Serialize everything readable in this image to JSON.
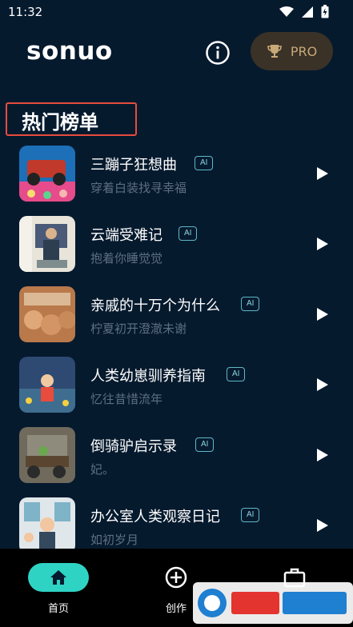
{
  "status_bar": {
    "time": "11:32"
  },
  "app_bar": {
    "title": "sonuo",
    "pro_label": "PRO"
  },
  "section": {
    "title": "热门榜单"
  },
  "songs": [
    {
      "title": "三蹦子狂想曲",
      "badge": "AI",
      "artist": "穿着白装找寻幸福"
    },
    {
      "title": "云端受难记",
      "badge": "AI",
      "artist": "抱着你睡觉觉"
    },
    {
      "title": "亲戚的十万个为什么",
      "badge": "AI",
      "artist": "柠夏初开澄澈未谢"
    },
    {
      "title": "人类幼崽驯养指南",
      "badge": "AI",
      "artist": "忆往昔惜流年"
    },
    {
      "title": "倒骑驴启示录",
      "badge": "AI",
      "artist": "妃。"
    },
    {
      "title": "办公室人类观察日记",
      "badge": "AI",
      "artist": "如初岁月"
    }
  ],
  "bottom_nav": [
    {
      "label": "首页",
      "icon": "home-icon",
      "active": true
    },
    {
      "label": "创作",
      "icon": "add-circle-icon",
      "active": false
    }
  ],
  "colors": {
    "background": "#061a2e",
    "accent": "#2fd3c4",
    "pro_bg": "#3a3227",
    "highlight_border": "#e74c3c"
  }
}
